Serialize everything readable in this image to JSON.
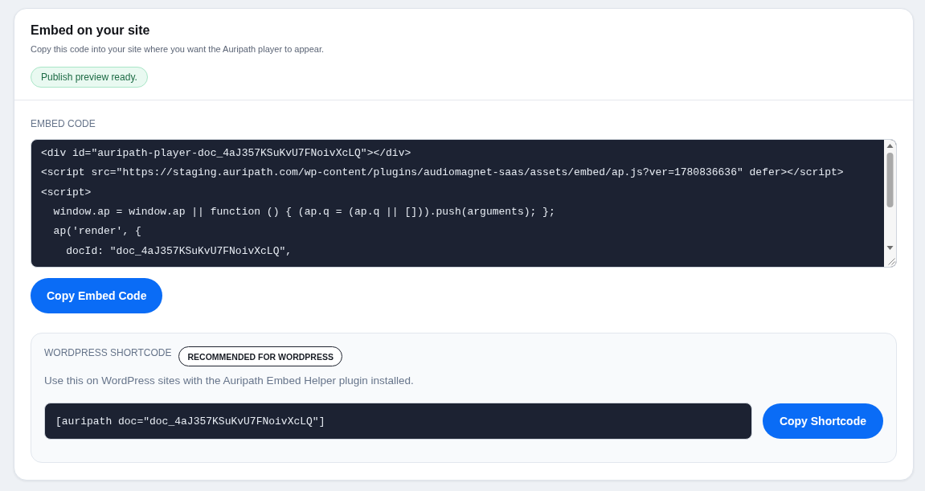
{
  "header": {
    "title": "Embed on your site",
    "description": "Copy this code into your site where you want the Auripath player to appear.",
    "status_badge": "Publish preview ready."
  },
  "embed_code": {
    "label": "EMBED CODE",
    "lines": [
      "<div id=\"auripath-player-doc_4aJ357KSuKvU7FNoivXcLQ\"></div>",
      "<script src=\"https://staging.auripath.com/wp-content/plugins/audiomagnet-saas/assets/embed/ap.js?ver=1780836636\" defer></script>",
      "<script>",
      "  window.ap = window.ap || function () { (ap.q = (ap.q || [])).push(arguments); };",
      "  ap('render', {",
      "    docId: \"doc_4aJ357KSuKvU7FNoivXcLQ\","
    ],
    "copy_button": "Copy Embed Code"
  },
  "wordpress_shortcode": {
    "label": "WORDPRESS SHORTCODE",
    "tag": "RECOMMENDED FOR WORDPRESS",
    "description": "Use this on WordPress sites with the Auripath Embed Helper plugin installed.",
    "shortcode": "[auripath doc=\"doc_4aJ357KSuKvU7FNoivXcLQ\"]",
    "copy_button": "Copy Shortcode"
  }
}
